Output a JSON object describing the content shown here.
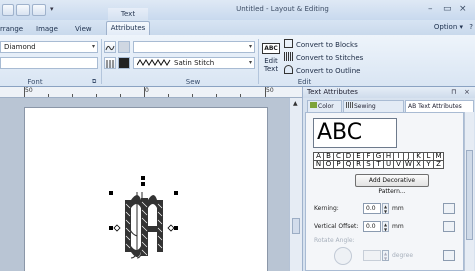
{
  "window": {
    "title": "Untitled - Layout & Editing",
    "context_tab": "Text",
    "controls": {
      "minimize": "–",
      "restore": "▭",
      "close": "×"
    }
  },
  "ribbon_tabs": {
    "arrange": "rrange",
    "image": "Image",
    "view": "View",
    "attributes": "Attributes",
    "option": "Option ▾"
  },
  "ribbon": {
    "font_combo": "Diamond",
    "stitch_type": "Satin Stitch",
    "groups": {
      "font": "Font",
      "sew": "Sew",
      "edit": "Edit"
    },
    "abc_button": "ABC",
    "edit_text_label": "Edit\nText",
    "convert_blocks": "Convert to Blocks",
    "convert_stitches": "Convert to Stitches",
    "convert_outline": "Convert to Outline"
  },
  "ruler": {
    "labels": [
      "50",
      "0",
      "50"
    ]
  },
  "canvas": {
    "monogram": "ABC"
  },
  "panel": {
    "title": "Text Attributes",
    "tabs": {
      "color": "Color",
      "sewing": "Sewing Attribu...",
      "text_attributes": "AB Text Attributes"
    },
    "preview_text": "ABC",
    "letter_rows": [
      [
        "A",
        "B",
        "C",
        "D",
        "E",
        "F",
        "G",
        "H",
        "I",
        "J",
        "K",
        "L",
        "M"
      ],
      [
        "N",
        "O",
        "P",
        "Q",
        "R",
        "S",
        "T",
        "U",
        "V",
        "W",
        "X",
        "Y",
        "Z"
      ]
    ],
    "add_pattern_button": "Add Decorative Pattern...",
    "kerning": {
      "label": "Kerning:",
      "value": "0.0",
      "unit": "mm"
    },
    "vertical_offset": {
      "label": "Vertical Offset:",
      "value": "0.0",
      "unit": "mm"
    },
    "rotate_angle": {
      "label": "Rotate Angle:",
      "unit": "degree"
    }
  },
  "colors": {
    "accent": "#c8d9ee",
    "canvas_bg": "#b9c5d4"
  }
}
